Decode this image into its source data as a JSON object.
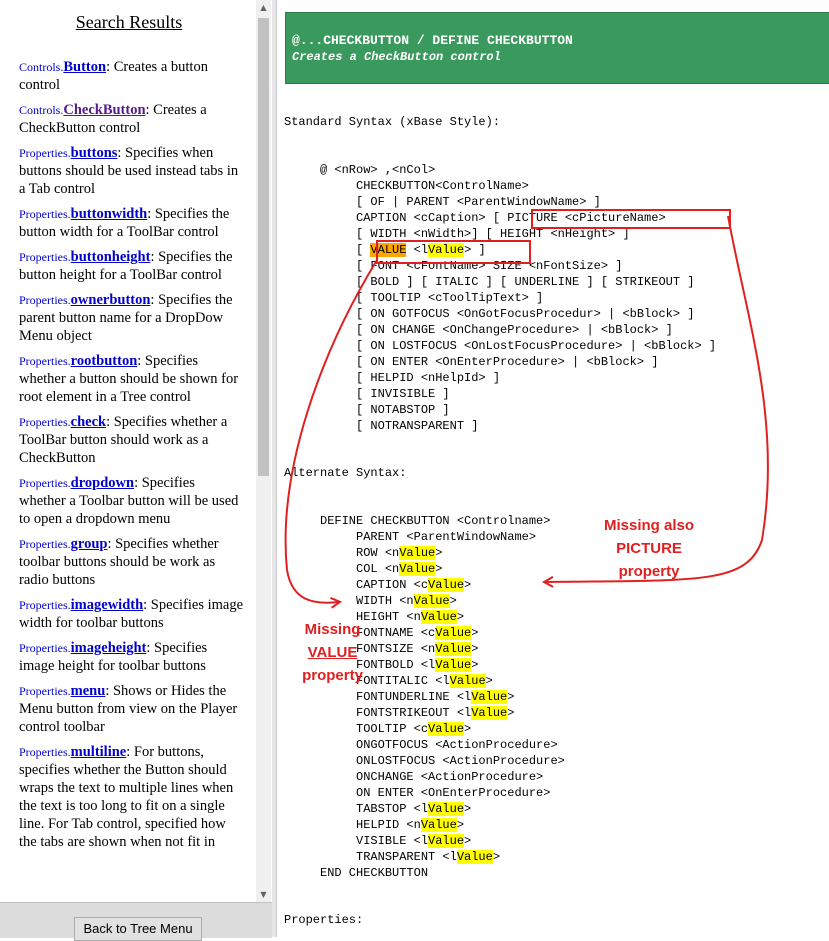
{
  "sidebar": {
    "title": "Search Results",
    "entries": [
      {
        "category": "Controls.",
        "name": "Button",
        "desc": ": Creates a button control"
      },
      {
        "category": "Controls.",
        "name": "CheckButton",
        "desc": ": Creates a CheckButton control"
      },
      {
        "category": "Properties.",
        "name": "buttons",
        "desc": ": Specifies when buttons should be used instead tabs in a Tab control"
      },
      {
        "category": "Properties.",
        "name": "buttonwidth",
        "desc": ": Specifies the button width for a ToolBar control"
      },
      {
        "category": "Properties.",
        "name": "buttonheight",
        "desc": ": Specifies the button height for a ToolBar control"
      },
      {
        "category": "Properties.",
        "name": "ownerbutton",
        "desc": ": Specifies the parent button name for a DropDow Menu object"
      },
      {
        "category": "Properties.",
        "name": "rootbutton",
        "desc": ": Specifies whether a button should be shown for root element in a Tree control"
      },
      {
        "category": "Properties.",
        "name": "check",
        "desc": ": Specifies whether a ToolBar button should work as a CheckButton"
      },
      {
        "category": "Properties.",
        "name": "dropdown",
        "desc": ": Specifies whether a Toolbar button will be used to open a dropdown menu"
      },
      {
        "category": "Properties.",
        "name": "group",
        "desc": ": Specifies whether toolbar buttons should be work as radio buttons"
      },
      {
        "category": "Properties.",
        "name": "imagewidth",
        "desc": ": Specifies image width for toolbar buttons"
      },
      {
        "category": "Properties.",
        "name": "imageheight",
        "desc": ": Specifies image height for toolbar buttons"
      },
      {
        "category": "Properties.",
        "name": "menu",
        "desc": ": Shows or Hides the Menu button from view on the Player control toolbar"
      },
      {
        "category": "Properties.",
        "name": "multiline",
        "desc": ": For buttons, specifies whether the Button should wraps the text to multiple lines when the text is too long to fit on a single line. For Tab control, specified how the tabs are shown when not fit in"
      }
    ],
    "back_button": "Back to Tree Menu"
  },
  "main": {
    "header_title": "@...CHECKBUTTON / DEFINE CHECKBUTTON",
    "header_subtitle": "Creates a CheckButton control",
    "standard_heading": "Standard Syntax (xBase Style):",
    "alternate_heading": "Alternate Syntax:",
    "properties_heading": "Properties:",
    "std_lines": [
      "     @ <nRow> ,<nCol>",
      "          CHECKBUTTON<ControlName>",
      "          [ OF | PARENT <ParentWindowName> ]",
      "          CAPTION <cCaption> [ PICTURE <cPictureName>",
      "          [ WIDTH <nWidth>] [ HEIGHT <nHeight> ]",
      "          [ VALUE <lValue> ]",
      "          [ FONT <cFontName> SIZE <nFontSize> ]",
      "          [ BOLD ] [ ITALIC ] [ UNDERLINE ] [ STRIKEOUT ]",
      "          [ TOOLTIP <cToolTipText> ]",
      "          [ ON GOTFOCUS <OnGotFocusProcedur> | <bBlock> ]",
      "          [ ON CHANGE <OnChangeProcedure> | <bBlock> ]",
      "          [ ON LOSTFOCUS <OnLostFocusProcedure> | <bBlock> ]",
      "          [ ON ENTER <OnEnterProcedure> | <bBlock> ]",
      "          [ HELPID <nHelpId> ]",
      "          [ INVISIBLE ]",
      "          [ NOTABSTOP ]",
      "          [ NOTRANSPARENT ]"
    ],
    "alt_lines": [
      "     DEFINE CHECKBUTTON <Controlname>",
      "          PARENT <ParentWindowName>",
      "          ROW <nValue>",
      "          COL <nValue>",
      "          CAPTION <cValue>",
      "          WIDTH <nValue>",
      "          HEIGHT <nValue>",
      "          FONTNAME <cValue>",
      "          FONTSIZE <nValue>",
      "          FONTBOLD <lValue>",
      "          FONTITALIC <lValue>",
      "          FONTUNDERLINE <lValue>",
      "          FONTSTRIKEOUT <lValue>",
      "          TOOLTIP <cValue>",
      "          ONGOTFOCUS <ActionProcedure>",
      "          ONLOSTFOCUS <ActionProcedure>",
      "          ONCHANGE <ActionProcedure>",
      "          ON ENTER <OnEnterProcedure>",
      "          TABSTOP <lValue>",
      "          HELPID <nValue>",
      "          VISIBLE <lValue>",
      "          TRANSPARENT <lValue>",
      "     END CHECKBUTTON"
    ],
    "highlight_word": "Value",
    "annotation_picture": [
      "Missing also",
      "PICTURE",
      "property"
    ],
    "annotation_value": [
      "Missing",
      "VALUE",
      "property"
    ]
  },
  "colors": {
    "header_bg": "#3a9a5e",
    "highlight": "#ffff00",
    "highlight_value_keyword": "#ffa500",
    "annotation_red": "#e02020",
    "link": "#0000cc",
    "visited_link": "#551a8b"
  }
}
